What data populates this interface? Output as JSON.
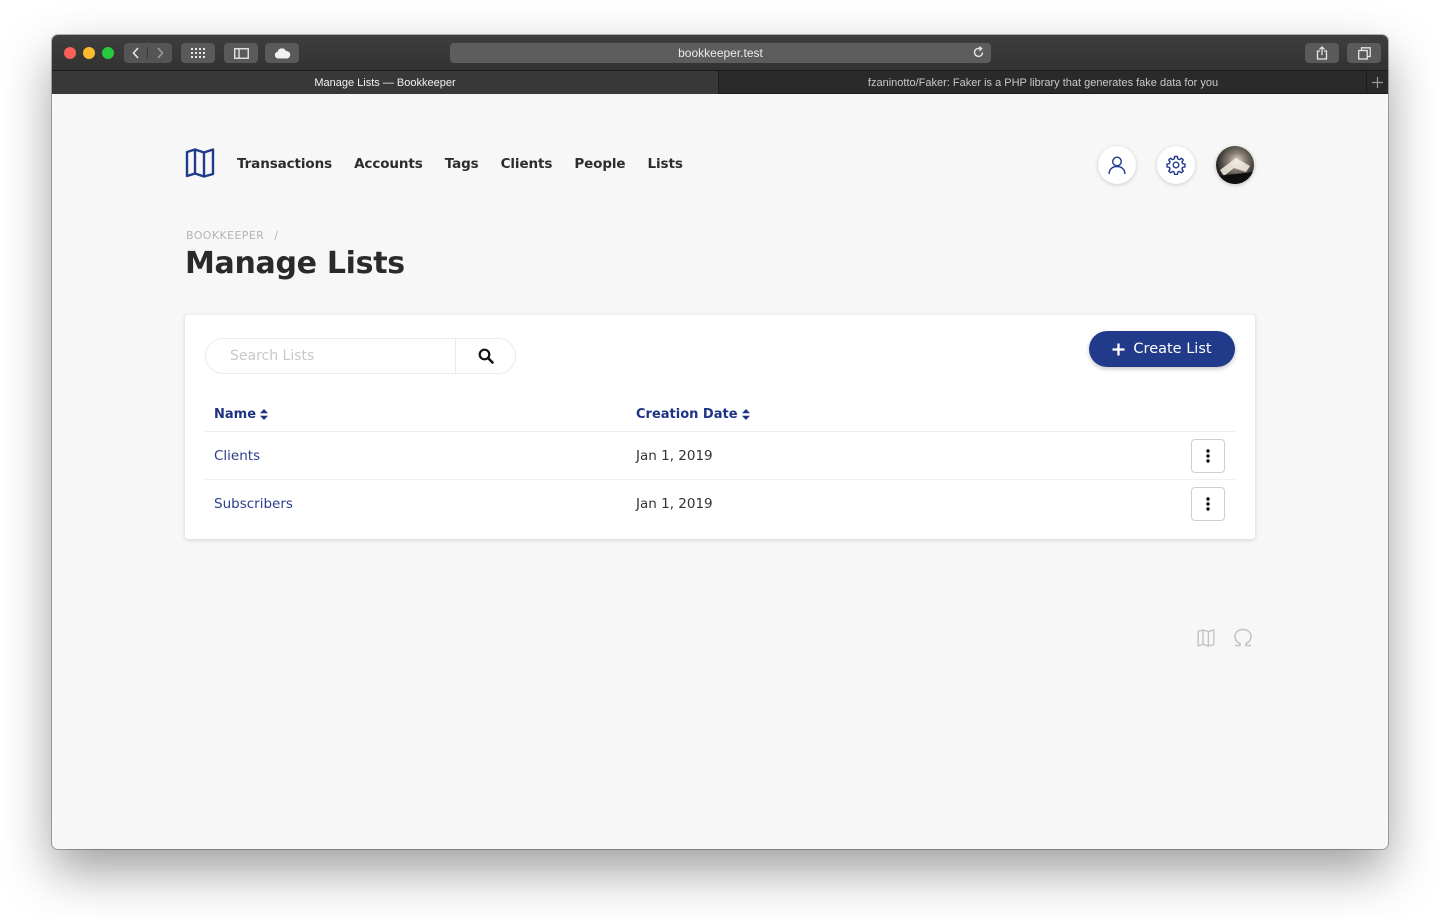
{
  "browser": {
    "url": "bookkeeper.test",
    "tabs": [
      {
        "label": "Manage Lists — Bookkeeper",
        "active": true
      },
      {
        "label": "fzaninotto/Faker: Faker is a PHP library that generates fake data for you",
        "active": false
      }
    ]
  },
  "nav": {
    "items": [
      "Transactions",
      "Accounts",
      "Tags",
      "Clients",
      "People",
      "Lists"
    ]
  },
  "header": {
    "icons": [
      "user-icon",
      "gear-icon",
      "avatar"
    ]
  },
  "breadcrumb": {
    "root": "BOOKKEEPER",
    "separator": "/"
  },
  "page": {
    "title": "Manage Lists",
    "create_label": "Create List"
  },
  "search": {
    "placeholder": "Search Lists",
    "value": ""
  },
  "table": {
    "columns": [
      "Name",
      "Creation Date"
    ],
    "rows": [
      {
        "name": "Clients",
        "date": "Jan 1, 2019"
      },
      {
        "name": "Subscribers",
        "date": "Jan 1, 2019"
      }
    ]
  },
  "footer": {
    "icons": [
      "map-icon",
      "omega-icon"
    ]
  },
  "colors": {
    "brand": "#213a8a",
    "link": "#2a3e8c",
    "header_text": "#1f3385"
  }
}
